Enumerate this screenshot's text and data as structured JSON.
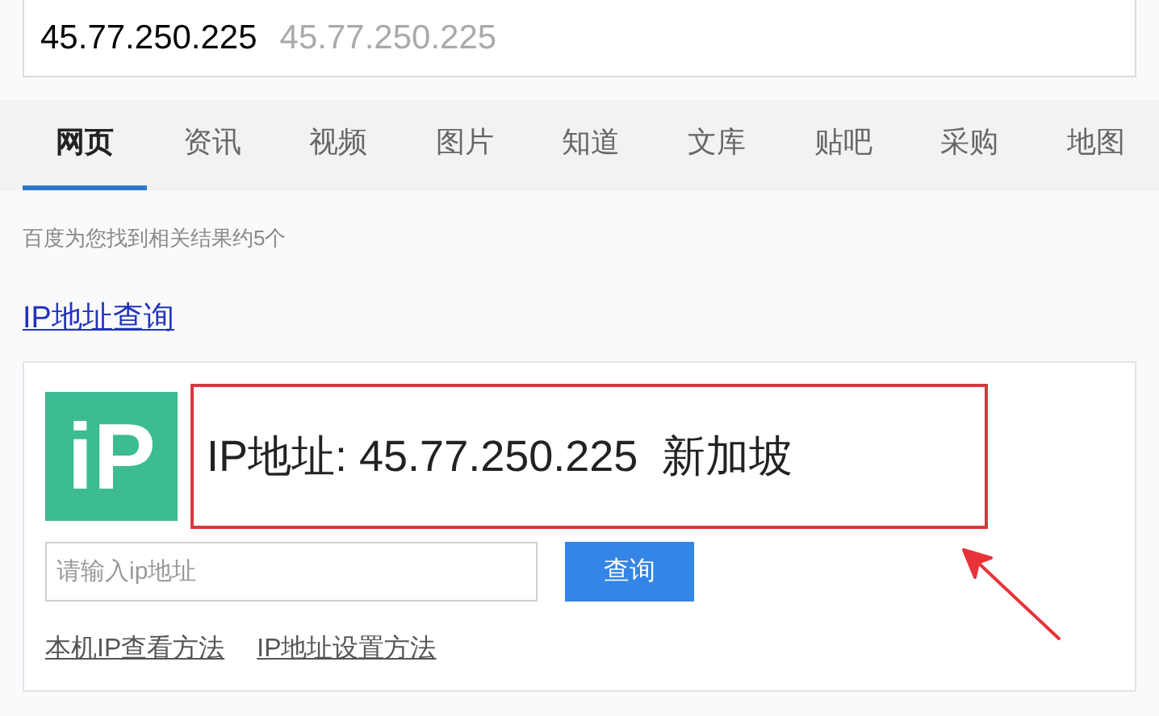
{
  "search": {
    "value": "45.77.250.225",
    "suggestion": "45.77.250.225"
  },
  "tabs": [
    {
      "label": "网页",
      "selected": true
    },
    {
      "label": "资讯",
      "selected": false
    },
    {
      "label": "视频",
      "selected": false
    },
    {
      "label": "图片",
      "selected": false
    },
    {
      "label": "知道",
      "selected": false
    },
    {
      "label": "文库",
      "selected": false
    },
    {
      "label": "贴吧",
      "selected": false
    },
    {
      "label": "采购",
      "selected": false
    },
    {
      "label": "地图",
      "selected": false
    }
  ],
  "result_count": "百度为您找到相关结果约5个",
  "result": {
    "title": "IP地址查询",
    "logo_text": "iP",
    "ip_line": "IP地址: 45.77.250.225  新加坡",
    "input_placeholder": "请输入ip地址",
    "button": "查询",
    "links": [
      "本机IP查看方法",
      "IP地址设置方法"
    ]
  }
}
